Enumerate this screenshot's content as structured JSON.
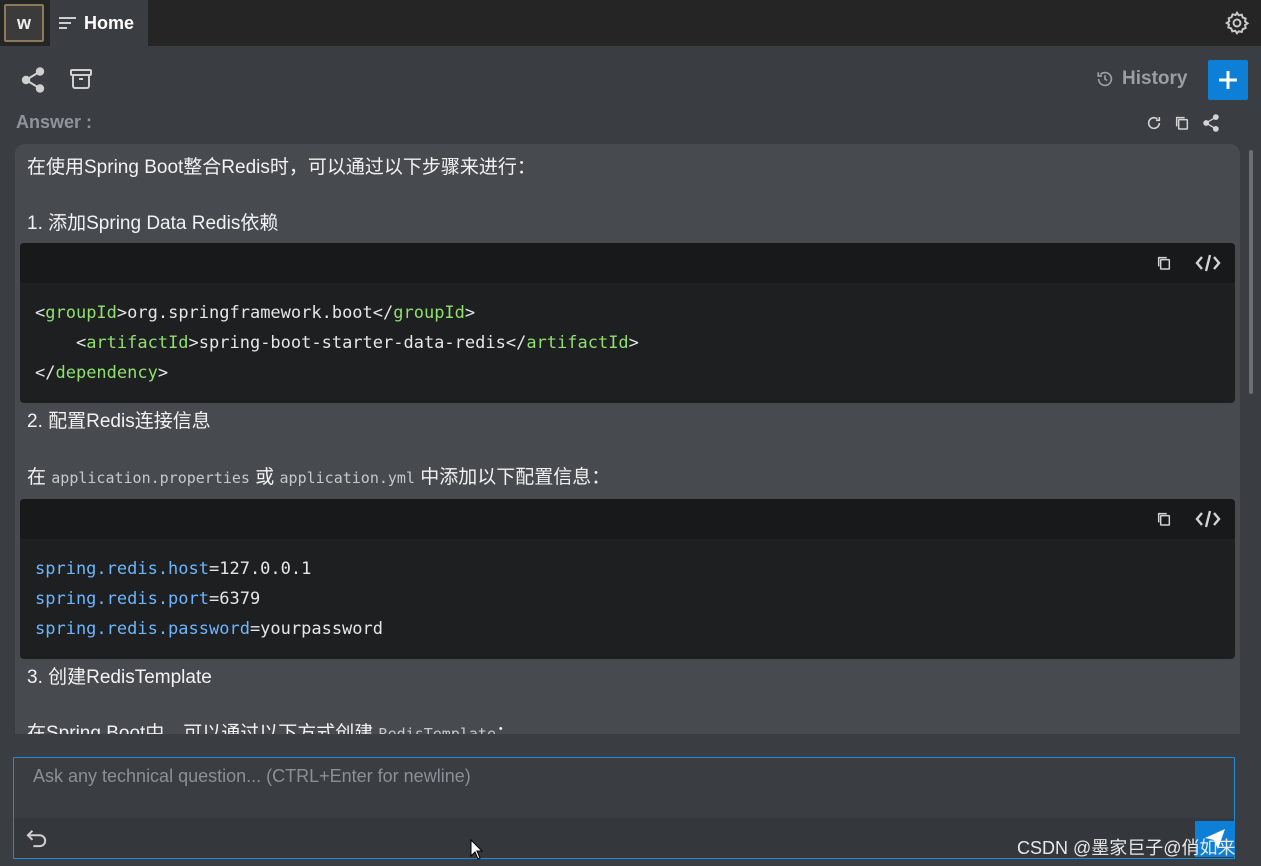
{
  "app": {
    "logo_letter": "w",
    "tab_label": "Home"
  },
  "toolbar": {
    "history_label": "History"
  },
  "answer": {
    "label": "Answer :",
    "intro": "在使用Spring Boot整合Redis时，可以通过以下步骤来进行：",
    "step1": "1. 添加Spring Data Redis依赖",
    "code1": {
      "l1_open": "<",
      "l1_tag": "groupId",
      "l1_mid": ">org.springframework.boot</",
      "l1_tag2": "groupId",
      "l1_close": ">",
      "l2_indent": "    <",
      "l2_tag": "artifactId",
      "l2_mid": ">spring-boot-starter-data-redis</",
      "l2_tag2": "artifactId",
      "l2_close": ">",
      "l3_open": "</",
      "l3_tag": "dependency",
      "l3_close": ">"
    },
    "step2": "2. 配置Redis连接信息",
    "config_pre": "在 ",
    "config_file1": "application.properties",
    "config_mid": " 或 ",
    "config_file2": "application.yml",
    "config_post": " 中添加以下配置信息：",
    "code2": {
      "l1_key": "spring.redis.host",
      "l1_val": "=127.0.0.1",
      "l2_key": "spring.redis.port",
      "l2_val": "=6379",
      "l3_key": "spring.redis.password",
      "l3_val": "=yourpassword"
    },
    "step3": "3. 创建RedisTemplate",
    "last_pre": "在Spring Boot中，可以通过以下方式创建 ",
    "last_code": "RedisTemplate",
    "last_post": "："
  },
  "input": {
    "placeholder": "Ask any technical question... (CTRL+Enter for newline)"
  },
  "watermark": "CSDN @墨家巨子@俏如来"
}
